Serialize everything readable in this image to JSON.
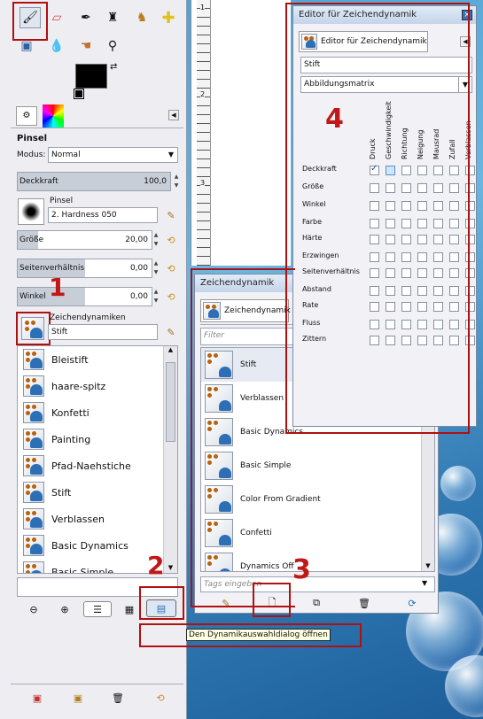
{
  "toolbox": {
    "tool_options_title": "Pinsel",
    "mode": {
      "label": "Modus:",
      "value": "Normal"
    },
    "opacity": {
      "label": "Deckkraft",
      "value": "100,0",
      "fraction": 1.0
    },
    "brush": {
      "label": "Pinsel",
      "value": "2. Hardness 050"
    },
    "size": {
      "label": "Größe",
      "value": "20,00",
      "fraction": 0.15
    },
    "aspect": {
      "label": "Seitenverhältnis",
      "value": "0,00",
      "fraction": 0.5
    },
    "angle": {
      "label": "Winkel",
      "value": "0,00",
      "fraction": 0.5
    },
    "dynamics": {
      "label": "Zeichendynamiken",
      "value": "Stift"
    },
    "list": [
      "Bleistift",
      "haare-spitz",
      "Konfetti",
      "Painting",
      "Pfad-Naehstiche",
      "Stift",
      "Verblassen",
      "Basic Dynamics",
      "Basic Simple"
    ]
  },
  "markers": {
    "m1": "1",
    "m2": "2",
    "m3": "3",
    "m4": "4"
  },
  "tooltip": "Den Dynamikauswahldialog öffnen",
  "dyn_dialog": {
    "title": "Zeichendynamik",
    "tab_label": "Zeichendynamik",
    "filter_placeholder": "Filter",
    "tags_placeholder": "Tags eingeben",
    "items": [
      "Stift",
      "Verblassen",
      "Basic Dynamics",
      "Basic Simple",
      "Color From Gradient",
      "Confetti",
      "Dynamics Off"
    ]
  },
  "editor": {
    "title": "Editor für Zeichendynamik",
    "tab_label": "Editor für Zeichendynamik",
    "name": "Stift",
    "mapping": "Abbildungsmatrix",
    "columns": [
      "Druck",
      "Geschwindigkeit",
      "Richtung",
      "Neigung",
      "Mausrad",
      "Zufall",
      "Verblassen"
    ],
    "rows": [
      "Deckkraft",
      "Größe",
      "Winkel",
      "Farbe",
      "Härte",
      "Erzwingen",
      "Seitenverhältnis",
      "Abstand",
      "Rate",
      "Fluss",
      "Zittern"
    ]
  },
  "ruler": {
    "r1": "1",
    "r2": "2",
    "r3": "3"
  },
  "colors": {
    "accent_red": "#b01010",
    "brand_blue": "#2d6fb5"
  }
}
